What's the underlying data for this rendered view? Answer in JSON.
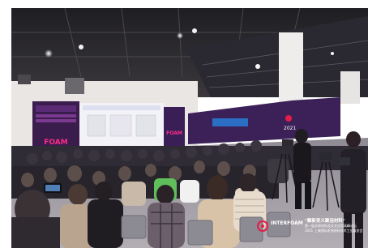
{
  "photo": {
    "type": "event-photo",
    "subject": "conference hall audience facing stage screens",
    "colors": {
      "ceiling": "#2b2a2c",
      "wall": "#e9e6e4",
      "screen_left": "#3a1d4d",
      "screen_center": "#f3f2f6",
      "screen_accent": "#d41d6f",
      "screen_right": "#3c2158",
      "floor": "#9e9aa1",
      "audience_dark": "#1d1b22"
    }
  },
  "screens": {
    "left_logo": "FOAM",
    "right_logo": "FOAM",
    "mid_panel_text": "2021",
    "right_panel_text": "2021"
  },
  "watermark": {
    "brand": "INTERFOAM",
    "line1": "\"聚新变义聚泡材料\"",
    "line2": "第一届全球材料及交叉应用高峰论坛",
    "line3": "2021 上海国际发泡材料技术工业展览会"
  }
}
